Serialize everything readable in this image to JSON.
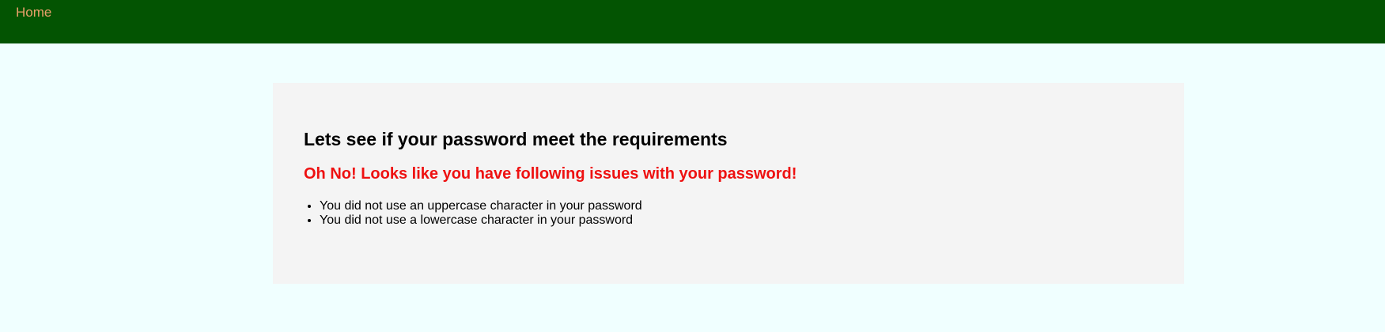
{
  "nav": {
    "home_label": "Home"
  },
  "card": {
    "title": "Lets see if your password meet the requirements",
    "error_heading": "Oh No! Looks like you have following issues with your password!",
    "issues": [
      "You did not use an uppercase character in your password",
      "You did not use a lowercase character in your password"
    ]
  },
  "colors": {
    "navbar_background": "#035402",
    "page_background": "#f0ffff",
    "card_background": "#f4f4f4",
    "nav_link": "#e8a06a",
    "error_text": "#ee1111"
  }
}
